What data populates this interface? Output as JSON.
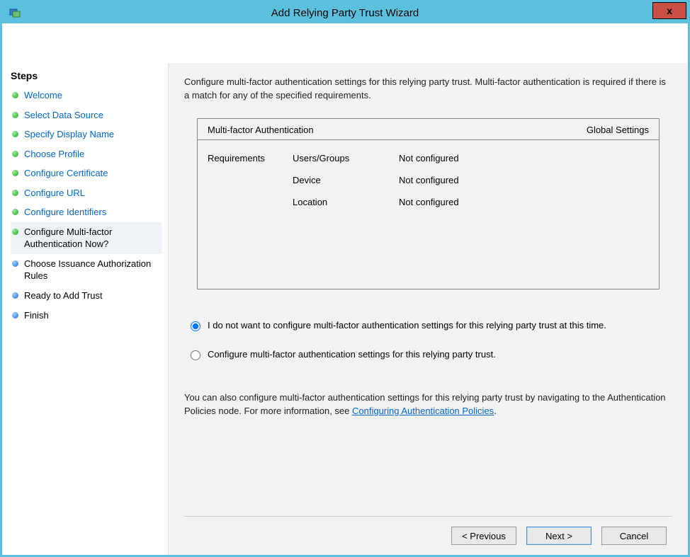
{
  "window": {
    "title": "Add Relying Party Trust Wizard",
    "close": "x"
  },
  "sidebar": {
    "heading": "Steps",
    "items": [
      {
        "label": "Welcome",
        "state": "done"
      },
      {
        "label": "Select Data Source",
        "state": "done"
      },
      {
        "label": "Specify Display Name",
        "state": "done"
      },
      {
        "label": "Choose Profile",
        "state": "done"
      },
      {
        "label": "Configure Certificate",
        "state": "done"
      },
      {
        "label": "Configure URL",
        "state": "done"
      },
      {
        "label": "Configure Identifiers",
        "state": "done"
      },
      {
        "label": "Configure Multi-factor Authentication Now?",
        "state": "current"
      },
      {
        "label": "Choose Issuance Authorization Rules",
        "state": "upcoming"
      },
      {
        "label": "Ready to Add Trust",
        "state": "upcoming"
      },
      {
        "label": "Finish",
        "state": "upcoming"
      }
    ]
  },
  "main": {
    "intro": "Configure multi-factor authentication settings for this relying party trust. Multi-factor authentication is required if there is a match for any of the specified requirements.",
    "mfa": {
      "heading_left": "Multi-factor Authentication",
      "heading_right": "Global Settings",
      "row_label": "Requirements",
      "rows": [
        {
          "name": "Users/Groups",
          "value": "Not configured"
        },
        {
          "name": "Device",
          "value": "Not configured"
        },
        {
          "name": "Location",
          "value": "Not configured"
        }
      ]
    },
    "radios": {
      "opt1": "I do not want to configure multi-factor authentication settings for this relying party trust at this time.",
      "opt2": "Configure multi-factor authentication settings for this relying party trust."
    },
    "footnote_pre": "You can also configure multi-factor authentication settings for this relying party trust by navigating to the Authentication Policies node. For more information, see ",
    "footnote_link": "Configuring Authentication Policies",
    "footnote_post": "."
  },
  "buttons": {
    "previous": "< Previous",
    "next": "Next >",
    "cancel": "Cancel"
  }
}
